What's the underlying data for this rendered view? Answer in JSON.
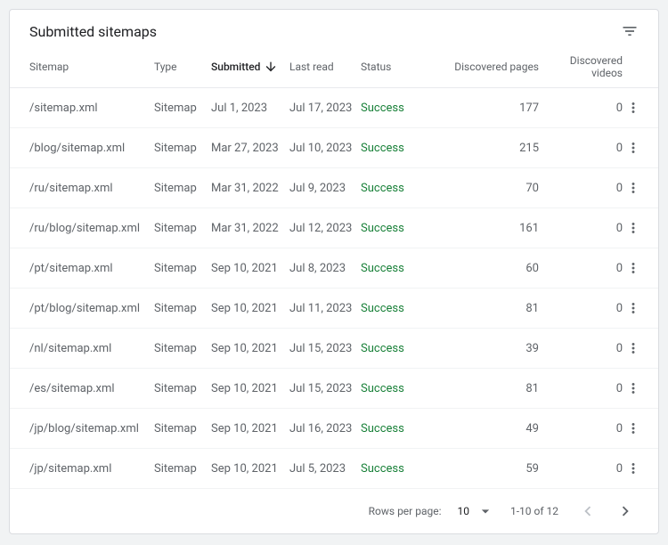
{
  "title": "Submitted sitemaps",
  "columns": {
    "sitemap": "Sitemap",
    "type": "Type",
    "submitted": "Submitted",
    "last_read": "Last read",
    "status": "Status",
    "discovered_pages": "Discovered pages",
    "discovered_videos": "Discovered videos"
  },
  "rows": [
    {
      "sitemap": "/sitemap.xml",
      "type": "Sitemap",
      "submitted": "Jul 1, 2023",
      "last_read": "Jul 17, 2023",
      "status": "Success",
      "pages": "177",
      "videos": "0"
    },
    {
      "sitemap": "/blog/sitemap.xml",
      "type": "Sitemap",
      "submitted": "Mar 27, 2023",
      "last_read": "Jul 10, 2023",
      "status": "Success",
      "pages": "215",
      "videos": "0"
    },
    {
      "sitemap": "/ru/sitemap.xml",
      "type": "Sitemap",
      "submitted": "Mar 31, 2022",
      "last_read": "Jul 9, 2023",
      "status": "Success",
      "pages": "70",
      "videos": "0"
    },
    {
      "sitemap": "/ru/blog/sitemap.xml",
      "type": "Sitemap",
      "submitted": "Mar 31, 2022",
      "last_read": "Jul 12, 2023",
      "status": "Success",
      "pages": "161",
      "videos": "0"
    },
    {
      "sitemap": "/pt/sitemap.xml",
      "type": "Sitemap",
      "submitted": "Sep 10, 2021",
      "last_read": "Jul 8, 2023",
      "status": "Success",
      "pages": "60",
      "videos": "0"
    },
    {
      "sitemap": "/pt/blog/sitemap.xml",
      "type": "Sitemap",
      "submitted": "Sep 10, 2021",
      "last_read": "Jul 11, 2023",
      "status": "Success",
      "pages": "81",
      "videos": "0"
    },
    {
      "sitemap": "/nl/sitemap.xml",
      "type": "Sitemap",
      "submitted": "Sep 10, 2021",
      "last_read": "Jul 15, 2023",
      "status": "Success",
      "pages": "39",
      "videos": "0"
    },
    {
      "sitemap": "/es/sitemap.xml",
      "type": "Sitemap",
      "submitted": "Sep 10, 2021",
      "last_read": "Jul 15, 2023",
      "status": "Success",
      "pages": "81",
      "videos": "0"
    },
    {
      "sitemap": "/jp/blog/sitemap.xml",
      "type": "Sitemap",
      "submitted": "Sep 10, 2021",
      "last_read": "Jul 16, 2023",
      "status": "Success",
      "pages": "49",
      "videos": "0"
    },
    {
      "sitemap": "/jp/sitemap.xml",
      "type": "Sitemap",
      "submitted": "Sep 10, 2021",
      "last_read": "Jul 5, 2023",
      "status": "Success",
      "pages": "59",
      "videos": "0"
    }
  ],
  "footer": {
    "rows_per_page_label": "Rows per page:",
    "rows_per_page_value": "10",
    "range": "1-10 of 12"
  }
}
